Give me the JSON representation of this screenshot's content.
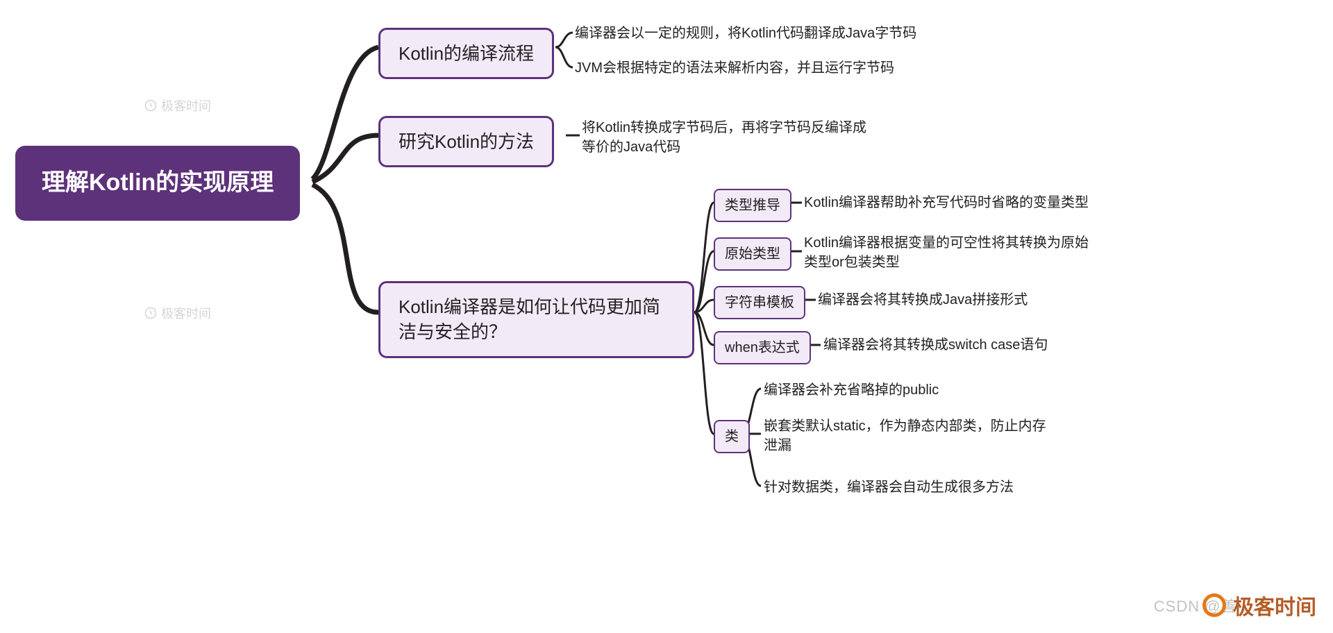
{
  "root": {
    "label": "理解Kotlin的实现原理"
  },
  "branches": [
    {
      "label": "Kotlin的编译流程",
      "leaves": [
        "编译器会以一定的规则，将Kotlin代码翻译成Java字节码",
        "JVM会根据特定的语法来解析内容，并且运行字节码"
      ]
    },
    {
      "label": "研究Kotlin的方法",
      "leaves": [
        "将Kotlin转换成字节码后，再将字节码反编译成\n等价的Java代码"
      ]
    },
    {
      "label": "Kotlin编译器是如何让代码更加简\n洁与安全的？",
      "subs": [
        {
          "label": "类型推导",
          "leaf": "Kotlin编译器帮助补充写代码时省略的变量类型"
        },
        {
          "label": "原始类型",
          "leaf": "Kotlin编译器根据变量的可空性将其转换为原始\n类型or包装类型"
        },
        {
          "label": "字符串模板",
          "leaf": "编译器会将其转换成Java拼接形式"
        },
        {
          "label": "when表达式",
          "leaf": "编译器会将其转换成switch case语句"
        },
        {
          "label": "类",
          "leaves": [
            "编译器会补充省略掉的public",
            "嵌套类默认static，作为静态内部类，防止内存\n泄漏",
            "针对数据类，编译器会自动生成很多方法"
          ]
        }
      ]
    }
  ],
  "watermark": "极客时间",
  "brand": "极客时间",
  "csdn": "CSDN @善 ..."
}
